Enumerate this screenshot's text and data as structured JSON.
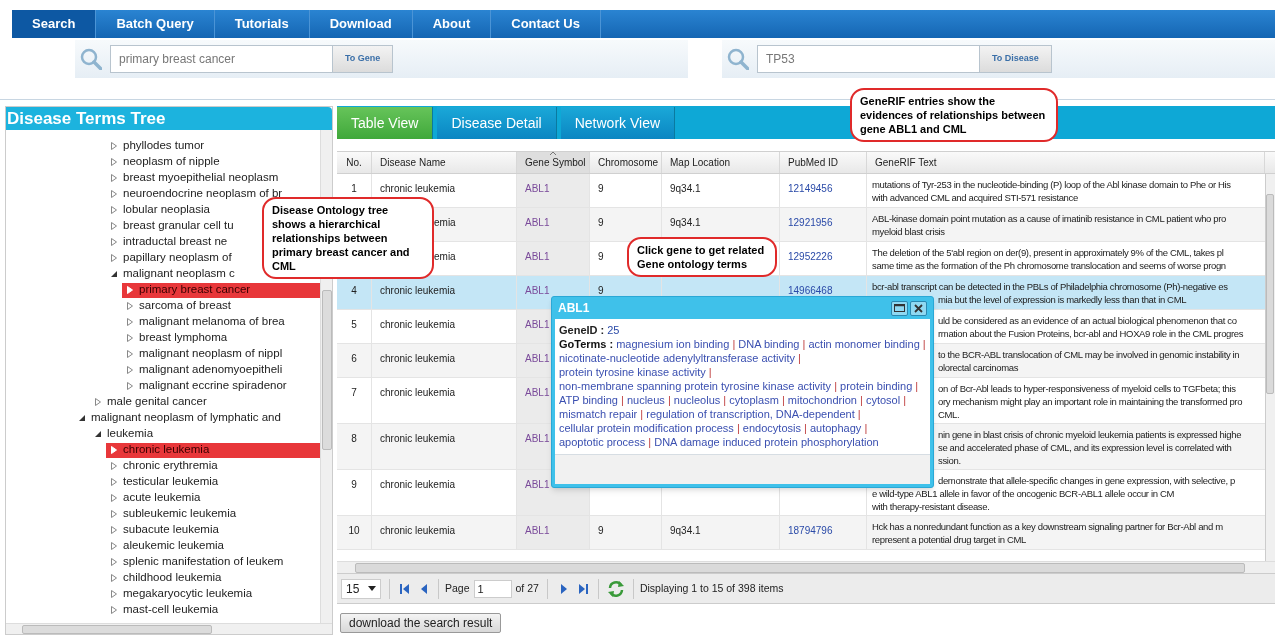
{
  "nav": [
    {
      "label": "Search",
      "selected": true
    },
    {
      "label": "Batch Query",
      "selected": false
    },
    {
      "label": "Tutorials",
      "selected": false
    },
    {
      "label": "Download",
      "selected": false
    },
    {
      "label": "About",
      "selected": false
    },
    {
      "label": "Contact Us",
      "selected": false
    }
  ],
  "searches": [
    {
      "value": "primary breast cancer",
      "button": "To Gene"
    },
    {
      "value": "TP53",
      "button": "To Disease"
    }
  ],
  "tree": {
    "title": "Disease Terms Tree",
    "items": [
      {
        "children": [
          {
            "children": [
              {
                "label": "phyllodes tumor",
                "expanded": false,
                "selected": false
              },
              {
                "label": "neoplasm of nipple",
                "expanded": false,
                "selected": false
              },
              {
                "label": "breast myoepithelial neoplasm",
                "expanded": false,
                "selected": false
              },
              {
                "label": "neuroendocrine neoplasm of br",
                "expanded": false,
                "selected": false
              },
              {
                "label": "lobular neoplasia",
                "expanded": false,
                "selected": false
              },
              {
                "label": "breast granular cell tu",
                "expanded": false,
                "selected": false
              },
              {
                "label": "intraductal breast ne",
                "expanded": false,
                "selected": false
              },
              {
                "label": "papillary neoplasm of",
                "expanded": false,
                "selected": false
              },
              {
                "label": "malignant neoplasm c",
                "expanded": true,
                "selected": false,
                "children": [
                  {
                    "label": "primary breast cancer",
                    "expanded": false,
                    "selected": true
                  },
                  {
                    "label": "sarcoma of breast",
                    "expanded": false,
                    "selected": false
                  },
                  {
                    "label": "malignant melanoma of brea",
                    "expanded": false,
                    "selected": false
                  },
                  {
                    "label": "breast lymphoma",
                    "expanded": false,
                    "selected": false
                  },
                  {
                    "label": "malignant neoplasm of nippl",
                    "expanded": false,
                    "selected": false
                  },
                  {
                    "label": "malignant adenomyoepitheli",
                    "expanded": false,
                    "selected": false
                  },
                  {
                    "label": "malignant eccrine spiradenor",
                    "expanded": false,
                    "selected": false
                  }
                ]
              }
            ]
          },
          {
            "label": "male genital cancer",
            "expanded": false,
            "selected": false
          }
        ]
      },
      {
        "label": "malignant neoplasm of lymphatic and",
        "expanded": true,
        "selected": false,
        "children": [
          {
            "label": "leukemia",
            "expanded": true,
            "selected": false,
            "children": [
              {
                "label": "chronic leukemia",
                "expanded": false,
                "selected": true
              },
              {
                "label": "chronic erythremia",
                "expanded": false,
                "selected": false
              },
              {
                "label": "testicular leukemia",
                "expanded": false,
                "selected": false
              },
              {
                "label": "acute leukemia",
                "expanded": false,
                "selected": false
              },
              {
                "label": "subleukemic leukemia",
                "expanded": false,
                "selected": false
              },
              {
                "label": "subacute leukemia",
                "expanded": false,
                "selected": false
              },
              {
                "label": "aleukemic leukemia",
                "expanded": false,
                "selected": false
              },
              {
                "label": "splenic manifestation of leukem",
                "expanded": false,
                "selected": false
              },
              {
                "label": "childhood leukemia",
                "expanded": false,
                "selected": false
              },
              {
                "label": "megakaryocytic leukemia",
                "expanded": false,
                "selected": false
              },
              {
                "label": "mast-cell leukemia",
                "expanded": false,
                "selected": false
              }
            ]
          }
        ]
      }
    ]
  },
  "tabs": [
    {
      "label": "Table View",
      "selected": true
    },
    {
      "label": "Disease Detail",
      "selected": false
    },
    {
      "label": "Network View",
      "selected": false
    }
  ],
  "table": {
    "columns": [
      "No.",
      "Disease Name",
      "Gene Symbol",
      "Chromosome",
      "Map Location",
      "PubMed ID",
      "GeneRIF Text"
    ],
    "rows": [
      {
        "no": "1",
        "disease": "chronic leukemia",
        "gene": "ABL1",
        "chromosome": "9",
        "map_location": "9q34.1",
        "pubmed": "12149456",
        "selected": false,
        "generif": [
          "mutations of Tyr-253 in the nucleotide-binding (P) loop of the Abl kinase domain to Phe or His",
          "with advanced CML and acquired STI-571 resistance"
        ]
      },
      {
        "disease": "emia",
        "gene": "ABL1",
        "chromosome": "9",
        "map_location": "9q34.1",
        "pubmed": "12921956",
        "selected": false,
        "generif": [
          "ABL-kinase domain point mutation as a cause of imatinib resistance in CML patient who pro",
          "myeloid blast crisis"
        ]
      },
      {
        "disease": "emia",
        "gene": "ABL1",
        "chromosome": "9",
        "pubmed": "12952226",
        "selected": false,
        "generif": [
          "The deletion of the 5'abl region on der(9), present in approximately 9% of the CML, takes pl",
          "same time as the formation of the Ph chromosome translocation and seems of worse progn"
        ]
      },
      {
        "no": "4",
        "disease": "chronic leukemia",
        "gene": "ABL1",
        "chromosome": "9",
        "pubmed": "14966468",
        "selected": true,
        "generif": [
          "bcr-abl transcript can be detected in the PBLs of Philadelphia chromosome (Ph)-negative es",
          "mia but the level of expression is markedly less than that in CML"
        ]
      },
      {
        "no": "5",
        "disease": "chronic leukemia",
        "gene": "ABL1",
        "selected": false,
        "generif": [
          "uld be considered as an evidence of an actual biological phenomenon that co",
          "rmation about the Fusion Proteins, bcr-abl and HOXA9 role in the CML progres"
        ]
      },
      {
        "no": "6",
        "disease": "chronic leukemia",
        "gene": "ABL1",
        "selected": false,
        "generif": [
          "to the BCR-ABL translocation of CML may be involved in genomic instability in",
          "olorectal carcinomas"
        ]
      },
      {
        "no": "7",
        "disease": "chronic leukemia",
        "gene": "ABL1",
        "selected": false,
        "generif": [
          "on of Bcr-Abl leads to hyper-responsiveness of myeloid cells to TGFbeta; this",
          "ory mechanism might play an important role in maintaining the transformed pro",
          "CML."
        ]
      },
      {
        "no": "8",
        "disease": "chronic leukemia",
        "gene": "ABL1",
        "selected": false,
        "generif": [
          "nin gene in blast crisis of chronic myeloid leukemia patients is expressed highe",
          "se and accelerated phase of CML, and its expression level is correlated with",
          "ssion."
        ]
      },
      {
        "no": "9",
        "disease": "chronic leukemia",
        "gene": "ABL1",
        "selected": false,
        "generif": [
          "demonstrate that allele-specific changes in gene expression, with selective, p",
          "e wild-type ABL1 allele in favor of the oncogenic BCR-ABL1 allele occur in CM",
          "with therapy-resistant disease."
        ]
      },
      {
        "no": "10",
        "disease": "chronic leukemia",
        "gene": "ABL1",
        "chromosome": "9",
        "map_location": "9q34.1",
        "pubmed": "18794796",
        "selected": false,
        "generif": [
          "Hck has a nonredundant function as a key downstream signaling partner for Bcr-Abl and m",
          "represent a potential drug target in CML"
        ]
      }
    ]
  },
  "pager": {
    "page_size": "15",
    "page_label": "Page",
    "page": "1",
    "page_count": "of 27",
    "summary": "Displaying 1 to 15 of 398 items"
  },
  "download_button": "download the search result",
  "popup": {
    "title": "ABL1",
    "gene_id_label": "GeneID :",
    "gene_id": "25",
    "go_terms_label": "GoTerms :",
    "separator": "|",
    "go_terms": [
      "magnesium ion binding",
      "DNA binding",
      "actin monomer binding",
      "nicotinate-nucleotide adenylyltransferase activity",
      "protein tyrosine kinase activity",
      "non-membrane spanning protein tyrosine kinase activity",
      "protein binding",
      "ATP binding",
      "nucleus",
      "nucleolus",
      "cytoplasm",
      "mitochondrion",
      "cytosol",
      "mismatch repair",
      "regulation of transcription, DNA-dependent",
      "cellular protein modification process",
      "endocytosis",
      "autophagy",
      "apoptotic process",
      "DNA damage induced protein phosphorylation"
    ]
  },
  "callouts": [
    {
      "text": "Disease Ontology tree shows a hierarchical relationships between primary breast cancer and CML"
    },
    {
      "text": "Click gene to get related Gene ontology terms"
    },
    {
      "text": "GeneRIF entries show the evidences of relationships between gene ABL1 and CML"
    }
  ]
}
